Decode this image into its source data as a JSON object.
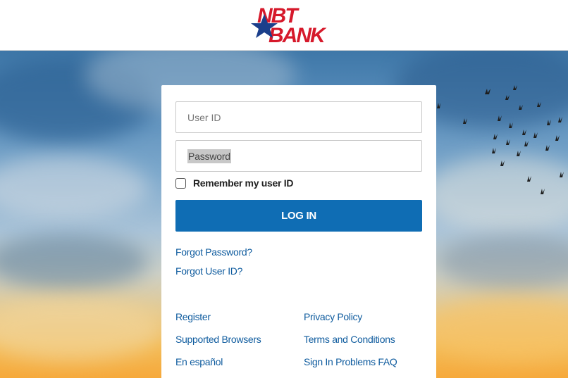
{
  "brand": {
    "logo_top": "NBT",
    "logo_bottom": "BANK",
    "color": "#d6192b",
    "star_color": "#1b3f8b"
  },
  "form": {
    "user_id_placeholder": "User ID",
    "password_placeholder": "Password",
    "remember_label": "Remember my user ID",
    "remember_checked": false,
    "login_label": "LOG IN",
    "accent": "#0f6db4"
  },
  "links": {
    "forgot_password": "Forgot Password?",
    "forgot_user_id": "Forgot User ID?",
    "register": "Register",
    "privacy_policy": "Privacy Policy",
    "supported_browsers": "Supported Browsers",
    "terms": "Terms and Conditions",
    "espanol": "En español",
    "sign_in_faq": "Sign In Problems FAQ"
  }
}
